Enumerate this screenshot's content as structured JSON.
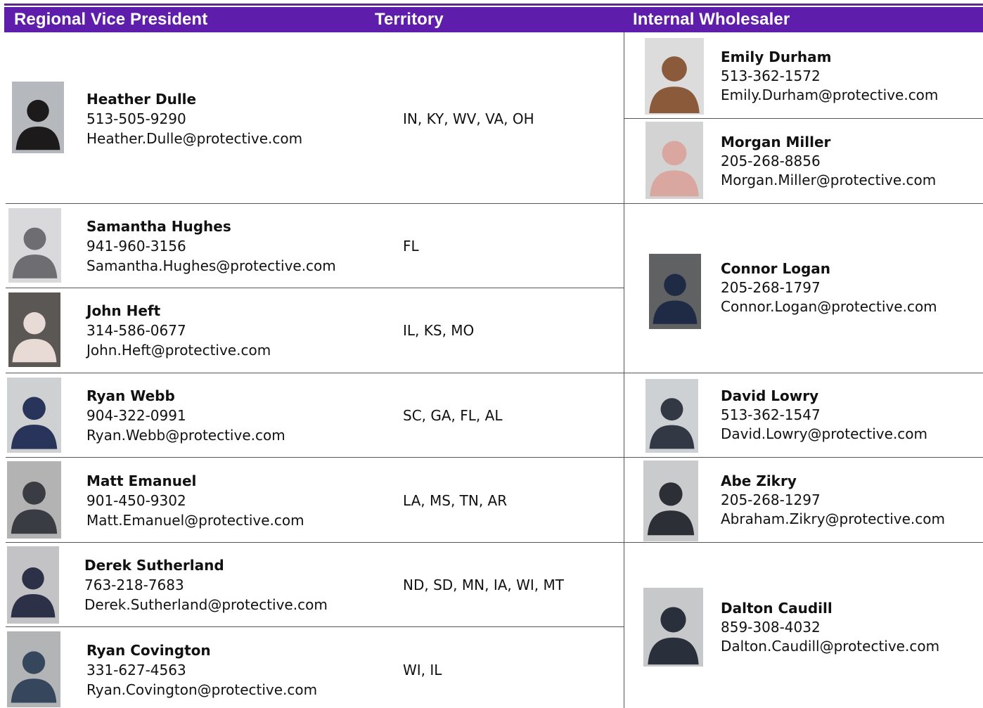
{
  "header": {
    "col_rvp": "Regional Vice President",
    "col_territory": "Territory",
    "col_iw": "Internal Wholesaler"
  },
  "colors": {
    "header_bg": "#5e1dab",
    "header_text": "#ffffff",
    "rule": "#555555"
  },
  "rvps": [
    {
      "name": "Heather Dulle",
      "phone": "513-505-9290",
      "email": "Heather.Dulle@protective.com",
      "territory": "IN, KY, WV, VA, OH"
    },
    {
      "name": "Samantha Hughes",
      "phone": "941-960-3156",
      "email": "Samantha.Hughes@protective.com",
      "territory": "FL"
    },
    {
      "name": "John Heft",
      "phone": "314-586-0677",
      "email": "John.Heft@protective.com",
      "territory": "IL, KS, MO"
    },
    {
      "name": "Ryan Webb",
      "phone": "904-322-0991",
      "email": "Ryan.Webb@protective.com",
      "territory": "SC, GA, FL, AL"
    },
    {
      "name": "Matt Emanuel",
      "phone": "901-450-9302",
      "email": "Matt.Emanuel@protective.com",
      "territory": "LA, MS, TN, AR"
    },
    {
      "name": "Derek Sutherland",
      "phone": "763-218-7683",
      "email": "Derek.Sutherland@protective.com",
      "territory": "ND, SD, MN, IA, WI, MT"
    },
    {
      "name": "Ryan Covington",
      "phone": "331-627-4563",
      "email": "Ryan.Covington@protective.com",
      "territory": "WI, IL"
    }
  ],
  "iws": [
    {
      "name": "Emily Durham",
      "phone": "513-362-1572",
      "email": "Emily.Durham@protective.com"
    },
    {
      "name": "Morgan Miller",
      "phone": "205-268-8856",
      "email": "Morgan.Miller@protective.com"
    },
    {
      "name": "Connor Logan",
      "phone": "205-268-1797",
      "email": "Connor.Logan@protective.com"
    },
    {
      "name": "David Lowry",
      "phone": "513-362-1547",
      "email": "David.Lowry@protective.com"
    },
    {
      "name": "Abe Zikry",
      "phone": "205-268-1297",
      "email": "Abraham.Zikry@protective.com"
    },
    {
      "name": "Dalton Caudill",
      "phone": "859-308-4032",
      "email": "Dalton.Caudill@protective.com"
    }
  ]
}
